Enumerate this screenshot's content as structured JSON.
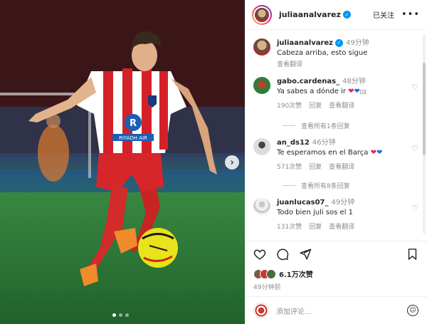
{
  "post": {
    "author": "juliaanalvarez",
    "follow_status": "已关注",
    "more": "•••",
    "caption_author": "juliaanalvarez",
    "caption_time": "49分钟",
    "caption_text": "Cabeza arriba, esto sigue",
    "see_translation": "查看翻译",
    "jersey_sponsor": "RIYADH AIR"
  },
  "comments": [
    {
      "user": "gabo.cardenas_",
      "time": "48分钟",
      "text": "Ya sabes a dónde ir",
      "likes": "190次赞",
      "reply": "回复",
      "translate": "查看翻译",
      "view_replies": "查看所有1条回复"
    },
    {
      "user": "an_ds12",
      "time": "46分钟",
      "text": "Te esperamos en el Barça",
      "likes": "571次赞",
      "reply": "回复",
      "translate": "查看翻译",
      "view_replies": "查看所有8条回复"
    },
    {
      "user": "juanlucas07_",
      "time": "49分钟",
      "text": "Todo bien juli sos el 1",
      "likes": "131次赞",
      "reply": "回复",
      "translate": "查看翻译"
    }
  ],
  "stats": {
    "likes": "6.1万次赞",
    "posted": "49分钟前"
  },
  "composer": {
    "placeholder": "添加评论..."
  },
  "colors": {
    "verified_blue": "#0095f6",
    "heart_red": "#e0245e",
    "heart_blue": "#1d6fd8"
  },
  "icons": {
    "like": "heart-icon",
    "comment": "comment-icon",
    "share": "share-icon",
    "save": "bookmark-icon",
    "emoji": "emoji-icon"
  }
}
